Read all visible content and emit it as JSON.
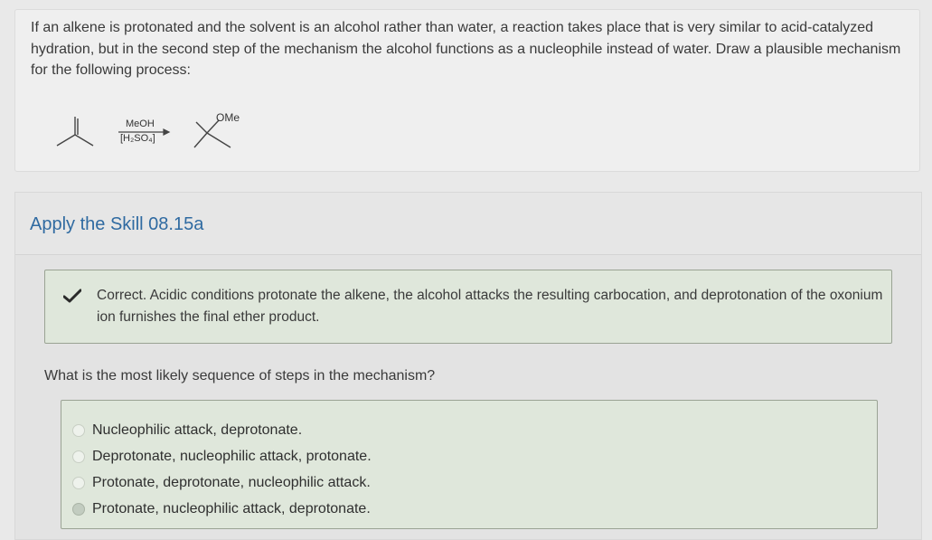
{
  "question": {
    "text": "If an alkene is protonated and the solvent is an alcohol rather than water, a reaction takes place that is very similar to acid-catalyzed hydration, but in the second step of the mechanism the alcohol functions as a nucleophile instead of water. Draw a plausible mechanism for the following process:",
    "scheme": {
      "reagent_top": "MeOH",
      "reagent_bottom": "[H₂SO₄]",
      "product_group": "OMe"
    }
  },
  "skill": {
    "title": "Apply the Skill 08.15a",
    "feedback": "Correct. Acidic conditions protonate the alkene, the alcohol attacks the resulting carbocation, and deprotonation of the oxonium ion furnishes the final ether product.",
    "prompt": "What is the most likely sequence of steps in the mechanism?",
    "options": [
      "Nucleophilic attack, deprotonate.",
      "Deprotonate, nucleophilic attack, protonate.",
      "Protonate, deprotonate, nucleophilic attack.",
      "Protonate, nucleophilic attack, deprotonate."
    ],
    "selected_index": 3
  },
  "colors": {
    "title": "#2f6aa1",
    "feedback_bg": "#dfe7db",
    "check": "#2a2a2a"
  }
}
